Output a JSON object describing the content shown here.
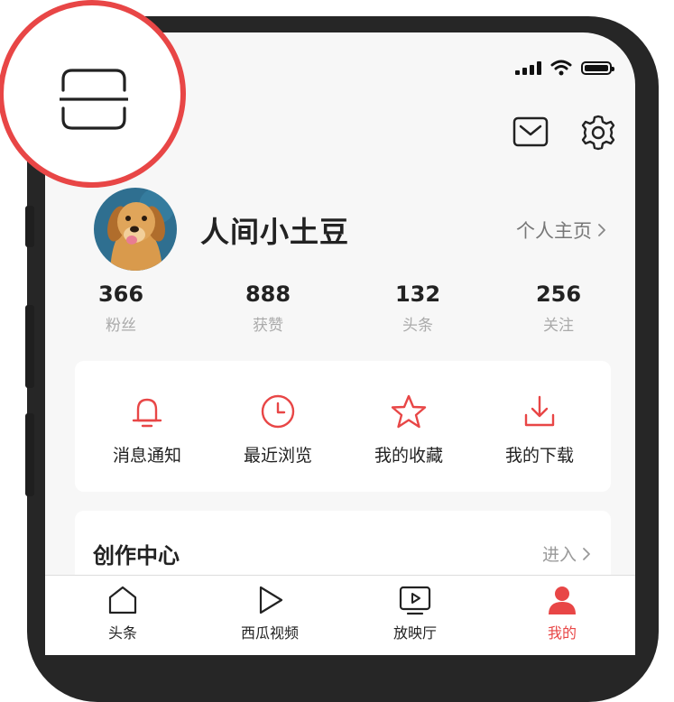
{
  "profile": {
    "username": "人间小土豆",
    "homepage_link": "个人主页"
  },
  "stats": [
    {
      "value": "366",
      "label": "粉丝"
    },
    {
      "value": "888",
      "label": "获赞"
    },
    {
      "value": "132",
      "label": "头条"
    },
    {
      "value": "256",
      "label": "关注"
    }
  ],
  "quick_actions": [
    {
      "label": "消息通知",
      "icon": "bell-icon"
    },
    {
      "label": "最近浏览",
      "icon": "clock-icon"
    },
    {
      "label": "我的收藏",
      "icon": "star-icon"
    },
    {
      "label": "我的下载",
      "icon": "download-icon"
    }
  ],
  "creator_center": {
    "title": "创作中心",
    "enter_label": "进入"
  },
  "tabbar": [
    {
      "label": "头条",
      "icon": "home-icon",
      "active": false
    },
    {
      "label": "西瓜视频",
      "icon": "play-icon",
      "active": false
    },
    {
      "label": "放映厅",
      "icon": "tv-icon",
      "active": false
    },
    {
      "label": "我的",
      "icon": "person-icon",
      "active": true
    }
  ],
  "colors": {
    "accent": "#e84646",
    "highlight_ring": "#e84646",
    "background": "#f7f7f7"
  }
}
